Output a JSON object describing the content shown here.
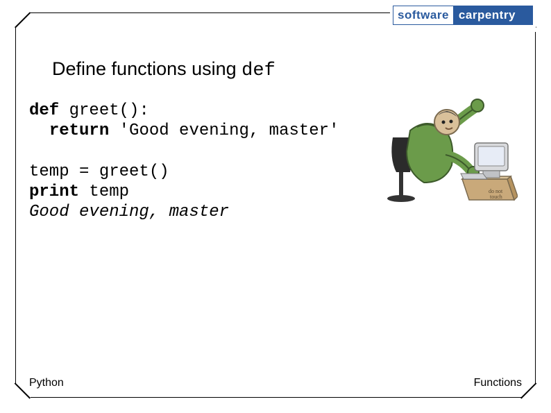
{
  "logo": {
    "left": "software",
    "right": "carpentry"
  },
  "heading": {
    "prefix": "Define functions using ",
    "keyword": "def"
  },
  "code": {
    "l1_kw": "def",
    "l1_rest": " greet():",
    "l2_kw": "return",
    "l2_rest": " 'Good evening, master'",
    "l3": "temp = greet()",
    "l4_kw": "print",
    "l4_rest": " temp",
    "l5_output": "Good evening, master"
  },
  "footer": {
    "left": "Python",
    "right": "Functions"
  },
  "illustration": {
    "alt": "cartoon-igor-at-computer"
  }
}
